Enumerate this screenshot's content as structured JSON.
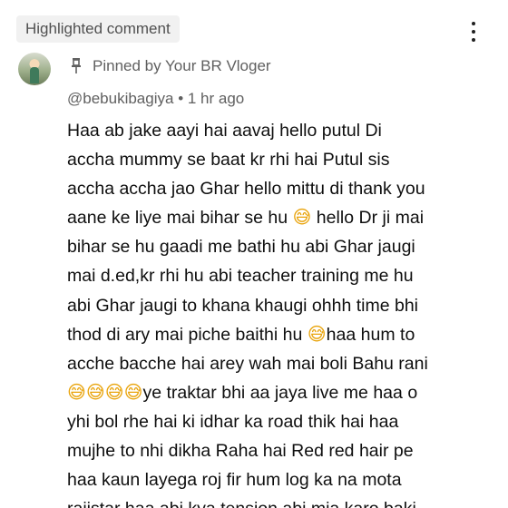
{
  "header": {
    "badge_label": "Highlighted comment",
    "menu_icon": "more-vertical-icon"
  },
  "comment": {
    "avatar_icon": "user-avatar",
    "pin_icon": "pin-icon",
    "pinned_text": "Pinned by Your BR Vloger",
    "author": "@bebukibagiya",
    "separator": "•",
    "time": "1 hr ago",
    "body_lines": [
      "Haa ab jake aayi hai aavaj hello putul Di",
      "accha mummy se baat kr rhi hai Putul sis",
      "accha accha jao Ghar hello mittu di thank you",
      "aane ke liye mai bihar se hu 😅 hello Dr ji mai",
      "bihar se hu gaadi me bathi hu abi Ghar jaugi",
      "mai d.ed,kr rhi hu abi teacher training me hu",
      "abi Ghar jaugi to khana khaugi ohhh time bhi",
      "thod di ary mai piche baithi hu 😅haa hum to",
      "acche bacche hai arey wah mai boli Bahu rani",
      "😅😅😅😅ye traktar bhi aa jaya live me haa o",
      "yhi bol rhe hai ki idhar ka road thik hai haa",
      "mujhe to nhi dikha Raha hai Red red hair pe",
      "haa kaun layega roj fir hum log ka na mota",
      "rajistar haa abi kya tension abi mja karo baki"
    ],
    "emoji_color": "#e9a40c"
  }
}
